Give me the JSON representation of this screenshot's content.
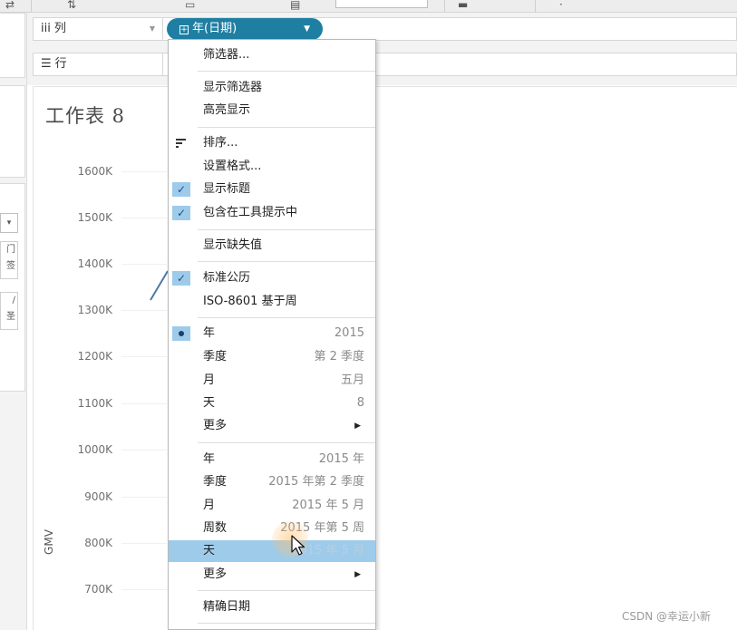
{
  "colors": {
    "accent": "#1f7fa2",
    "menu_highlight": "#9ecbea",
    "check": "#1d4f8a"
  },
  "icons": {
    "columns": "columns-icon",
    "rows": "rows-icon",
    "pill_expand": "plus-box-icon",
    "pill_menu": "caret-down-icon",
    "sort": "sort-icon",
    "check": "checkmark-icon",
    "radio": "bullet-icon",
    "submenu": "submenu-arrow-icon",
    "cursor": "mouse-pointer-icon"
  },
  "shelves": {
    "columns_glyph": "iii",
    "columns_label": "列",
    "rows_glyph": "☰",
    "rows_label": "行",
    "pill_label": "年(日期)"
  },
  "sheet": {
    "title": "工作表 8",
    "y_axis_label": "GMV",
    "y_ticks": [
      "1600K",
      "1500K",
      "1400K",
      "1300K",
      "1200K",
      "1100K",
      "1000K",
      "900K",
      "800K",
      "700K"
    ]
  },
  "menu": {
    "filter": "筛选器...",
    "show_filter": "显示筛选器",
    "highlight": "高亮显示",
    "sort": "排序...",
    "format": "设置格式...",
    "show_header": "显示标题",
    "include_tooltip": "包含在工具提示中",
    "show_missing": "显示缺失值",
    "standard_calendar": "标准公历",
    "iso_week": "ISO-8601 基于周",
    "discrete": [
      {
        "label": "年",
        "value": "2015"
      },
      {
        "label": "季度",
        "value": "第 2 季度"
      },
      {
        "label": "月",
        "value": "五月"
      },
      {
        "label": "天",
        "value": "8"
      },
      {
        "label": "更多",
        "value": ""
      }
    ],
    "continuous": [
      {
        "label": "年",
        "value": "2015 年"
      },
      {
        "label": "季度",
        "value": "2015 年第 2 季度"
      },
      {
        "label": "月",
        "value": "2015 年 5 月"
      },
      {
        "label": "周数",
        "value": "2015 年第 5 周"
      },
      {
        "label": "天",
        "value": "2015 年 5 月"
      },
      {
        "label": "更多",
        "value": ""
      }
    ],
    "exact_date": "精确日期"
  },
  "left_panel": {
    "dropdown": "▾",
    "card1": "门\n签",
    "card2": "∕\n圣"
  },
  "watermark": "CSDN @幸运小新"
}
